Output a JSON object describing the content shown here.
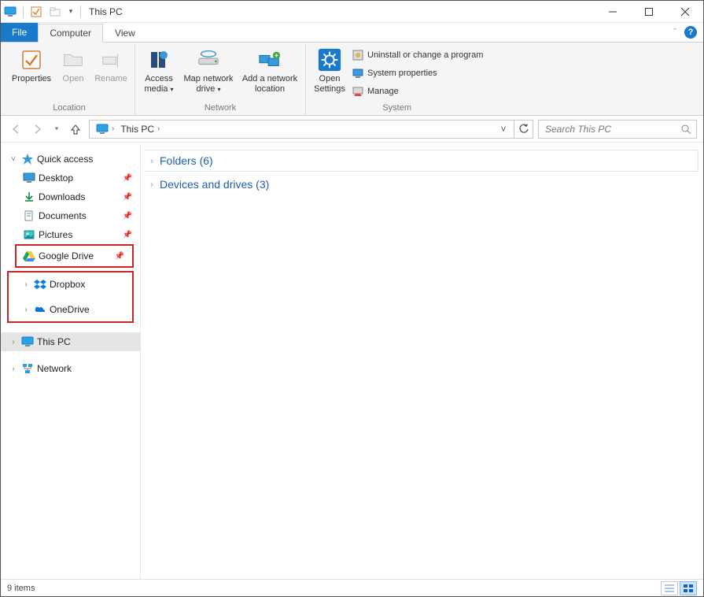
{
  "window": {
    "title": "This PC"
  },
  "tabs": {
    "file": "File",
    "computer": "Computer",
    "view": "View"
  },
  "ribbon": {
    "location": {
      "label": "Location",
      "properties": "Properties",
      "open": "Open",
      "rename": "Rename"
    },
    "network": {
      "label": "Network",
      "access_media": "Access\nmedia",
      "map_drive": "Map network\ndrive",
      "add_location": "Add a network\nlocation"
    },
    "system": {
      "label": "System",
      "open_settings": "Open\nSettings",
      "uninstall": "Uninstall or change a program",
      "properties": "System properties",
      "manage": "Manage"
    }
  },
  "address": {
    "crumb1": "This PC",
    "search_placeholder": "Search This PC"
  },
  "sidebar": {
    "quick_access": "Quick access",
    "desktop": "Desktop",
    "downloads": "Downloads",
    "documents": "Documents",
    "pictures": "Pictures",
    "google_drive": "Google Drive",
    "dropbox": "Dropbox",
    "onedrive": "OneDrive",
    "this_pc": "This PC",
    "network": "Network"
  },
  "main": {
    "folders_label": "Folders (6)",
    "devices_label": "Devices and drives (3)"
  },
  "status": {
    "items": "9 items"
  }
}
